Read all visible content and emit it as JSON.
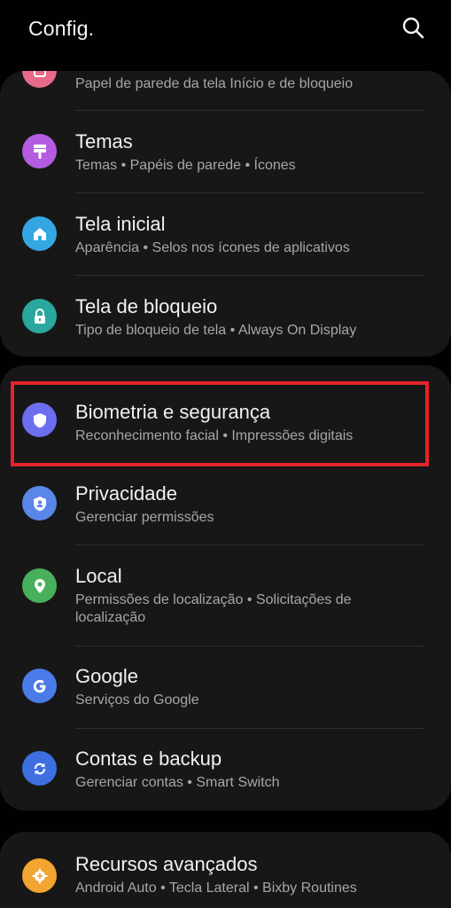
{
  "header": {
    "title": "Config.",
    "search_icon": "search-icon"
  },
  "cards": [
    {
      "items": [
        {
          "key": "wallpaper",
          "title": "",
          "subtitle": "Papel de parede da tela Início e de bloqueio",
          "icon": "wallpaper-icon",
          "color": "#e86a8b"
        },
        {
          "key": "themes",
          "title": "Temas",
          "subtitle": "Temas  •  Papéis de parede  •  Ícones",
          "icon": "brush-icon",
          "color": "#b45ce0"
        },
        {
          "key": "home-screen",
          "title": "Tela inicial",
          "subtitle": "Aparência  •  Selos nos ícones de aplicativos",
          "icon": "home-icon",
          "color": "#34a7e3"
        },
        {
          "key": "lock-screen",
          "title": "Tela de bloqueio",
          "subtitle": "Tipo de bloqueio de tela  •  Always On Display",
          "icon": "lock-icon",
          "color": "#2aa89d"
        }
      ]
    },
    {
      "items": [
        {
          "key": "biometrics",
          "title": "Biometria e segurança",
          "subtitle": "Reconhecimento facial  •  Impressões digitais",
          "icon": "shield-icon",
          "color": "#6c6ef0"
        },
        {
          "key": "privacy",
          "title": "Privacidade",
          "subtitle": "Gerenciar permissões",
          "icon": "privacy-shield-icon",
          "color": "#5a86e8"
        },
        {
          "key": "location",
          "title": "Local",
          "subtitle": "Permissões de localização  •  Solicitações de",
          "subtitle2": "localização",
          "icon": "location-pin-icon",
          "color": "#48b05a"
        },
        {
          "key": "google",
          "title": "Google",
          "subtitle": "Serviços do Google",
          "icon": "google-icon",
          "color": "#4a7be8"
        },
        {
          "key": "accounts",
          "title": "Contas e backup",
          "subtitle": "Gerenciar contas  •  Smart Switch",
          "icon": "sync-icon",
          "color": "#3d6fe0"
        }
      ]
    },
    {
      "items": [
        {
          "key": "advanced",
          "title": "Recursos avançados",
          "subtitle": "Android Auto  •  Tecla Lateral  •  Bixby Routines",
          "icon": "gear-plus-icon",
          "color": "#f2a531"
        }
      ]
    }
  ],
  "highlight": {
    "color": "#e3242b"
  }
}
